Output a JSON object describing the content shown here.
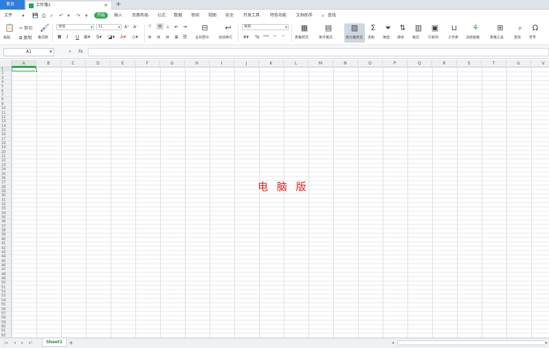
{
  "titlebar": {
    "home_tab": "首页",
    "doc_title": "工作簿1",
    "close_glyph": "✕",
    "new_tab_glyph": "+"
  },
  "menubar": {
    "file_label": "文件",
    "tabs": [
      "开始",
      "插入",
      "页面布局",
      "公式",
      "数据",
      "审阅",
      "视图",
      "安全",
      "开发工具",
      "特色功能",
      "文档助手"
    ],
    "search_label": "查找"
  },
  "ribbon": {
    "paste_label": "粘贴",
    "cut_label": "剪切",
    "copy_label": "复制",
    "format_painter_label": "格式刷",
    "font_name": "宋体",
    "font_size": "11",
    "merge_label": "合并居中",
    "wrap_label": "自动换行",
    "number_format": "常规",
    "table_style_label": "表格样式",
    "cond_format_label": "条件格式",
    "cell_style_label": "单元格样式",
    "sum_label": "求和",
    "filter_label": "筛选",
    "sort_label": "排序",
    "fill_label": "格式",
    "row_col_label": "行和列",
    "worksheet_label": "工作表",
    "freeze_label": "冻结窗格",
    "table_tools_label": "表格工具",
    "find_label": "查找",
    "symbol_label": "符号"
  },
  "formulabar": {
    "cell_name": "A1",
    "formula_value": ""
  },
  "grid": {
    "columns": [
      "A",
      "B",
      "C",
      "D",
      "E",
      "F",
      "G",
      "H",
      "I",
      "J",
      "K",
      "L",
      "M",
      "N",
      "O",
      "P",
      "Q",
      "R",
      "S",
      "T",
      "U",
      "V"
    ],
    "row_count": 62,
    "selected_cell": "A1"
  },
  "watermark": "电 脑 版",
  "sheetbar": {
    "sheet_name": "Sheet1",
    "add_glyph": "+"
  },
  "colors": {
    "accent": "#2fa84f",
    "home_tab": "#2f7fd8",
    "watermark": "#e02020"
  }
}
